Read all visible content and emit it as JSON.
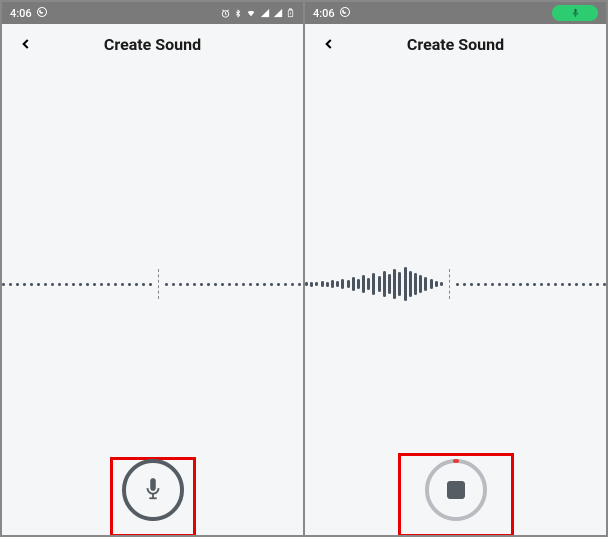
{
  "status": {
    "time": "4:06",
    "whatsapp_icon": "whatsapp"
  },
  "header": {
    "title": "Create Sound"
  },
  "screens": {
    "left": {
      "state": "idle",
      "button_icon": "microphone"
    },
    "right": {
      "state": "recording",
      "button_icon": "stop"
    }
  }
}
